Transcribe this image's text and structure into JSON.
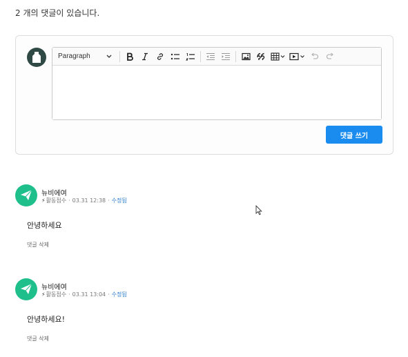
{
  "comments_header": {
    "text": "2 개의 댓글이 있습니다."
  },
  "editor": {
    "format_select": "Paragraph",
    "toolbar_icons": [
      "bold-icon",
      "italic-icon",
      "link-icon",
      "bulleted-list-icon",
      "numbered-list-icon",
      "outdent-icon",
      "indent-icon",
      "image-icon",
      "quote-icon",
      "table-icon",
      "media-icon",
      "undo-icon",
      "redo-icon"
    ],
    "submit_label": "댓글 쓰기",
    "accent_color": "#1a8cf0"
  },
  "comments": [
    {
      "author": "뉴비에여",
      "activity_label": "활동점수",
      "timestamp": "03.31 12:38",
      "edited_label": "수정됨",
      "body": "안녕하세요",
      "delete_label": "댓글 삭제"
    },
    {
      "author": "뉴비에여",
      "activity_label": "활동점수",
      "timestamp": "03.31 13:04",
      "edited_label": "수정됨",
      "body": "안녕하세요!",
      "delete_label": "댓글 삭제"
    }
  ]
}
